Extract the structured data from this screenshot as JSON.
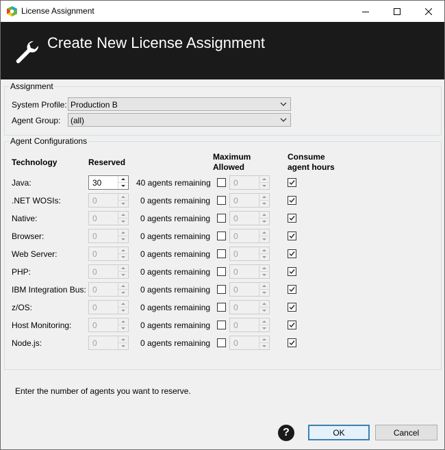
{
  "window": {
    "title": "License Assignment"
  },
  "header": {
    "title": "Create New License Assignment"
  },
  "assignment": {
    "legend": "Assignment",
    "system_profile_label": "System Profile:",
    "system_profile_value": "Production B",
    "agent_group_label": "Agent Group:",
    "agent_group_value": "(all)"
  },
  "agent_config": {
    "legend": "Agent Configurations",
    "headers": {
      "technology": "Technology",
      "reserved": "Reserved",
      "maximum_line1": "Maximum",
      "maximum_line2": "Allowed",
      "consume_line1": "Consume",
      "consume_line2": "agent hours"
    },
    "rows": [
      {
        "label": "Java:",
        "reserved": "30",
        "remaining": "40 agents remaining",
        "max_checked": false,
        "max": "0",
        "consume": true
      },
      {
        "label": ".NET WOSIs:",
        "reserved": "0",
        "remaining": "0 agents remaining",
        "max_checked": false,
        "max": "0",
        "consume": true
      },
      {
        "label": "Native:",
        "reserved": "0",
        "remaining": "0 agents remaining",
        "max_checked": false,
        "max": "0",
        "consume": true
      },
      {
        "label": "Browser:",
        "reserved": "0",
        "remaining": "0 agents remaining",
        "max_checked": false,
        "max": "0",
        "consume": true
      },
      {
        "label": "Web Server:",
        "reserved": "0",
        "remaining": "0 agents remaining",
        "max_checked": false,
        "max": "0",
        "consume": true
      },
      {
        "label": "PHP:",
        "reserved": "0",
        "remaining": "0 agents remaining",
        "max_checked": false,
        "max": "0",
        "consume": true
      },
      {
        "label": "IBM Integration Bus:",
        "reserved": "0",
        "remaining": "0 agents remaining",
        "max_checked": false,
        "max": "0",
        "consume": true
      },
      {
        "label": "z/OS:",
        "reserved": "0",
        "remaining": "0 agents remaining",
        "max_checked": false,
        "max": "0",
        "consume": true
      },
      {
        "label": "Host Monitoring:",
        "reserved": "0",
        "remaining": "0 agents remaining",
        "max_checked": false,
        "max": "0",
        "consume": true
      },
      {
        "label": "Node.js:",
        "reserved": "0",
        "remaining": "0 agents remaining",
        "max_checked": false,
        "max": "0",
        "consume": true
      }
    ]
  },
  "status_text": "Enter the number of agents you want to reserve.",
  "buttons": {
    "help": "?",
    "ok": "OK",
    "cancel": "Cancel"
  },
  "colors": {
    "header_bg": "#1a1a1a",
    "default_button_border": "#3c7fb1"
  }
}
